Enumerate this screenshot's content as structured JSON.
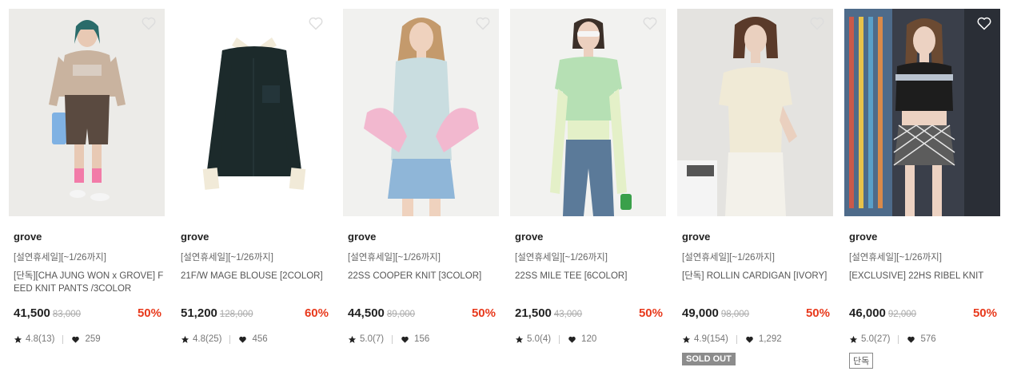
{
  "products": [
    {
      "brand": "grove",
      "promo": "[설연휴세일][~1/26까지]",
      "title": "[단독][CHA JUNG WON x GROVE] FEED KNIT PANTS /3COLOR",
      "price": "41,500",
      "original_price": "83,000",
      "discount": "50%",
      "rating": "4.8(13)",
      "likes": "259",
      "badge": "",
      "image": {
        "bg": "#ecebe8",
        "top": "#c9b39f",
        "bottom": "#5a4a40",
        "hair": "#2a6b6a",
        "skin": "#e8c9b4"
      }
    },
    {
      "brand": "grove",
      "promo": "[설연휴세일][~1/26까지]",
      "title": "21F/W MAGE BLOUSE [2COLOR]",
      "price": "51,200",
      "original_price": "128,000",
      "discount": "60%",
      "rating": "4.8(25)",
      "likes": "456",
      "badge": "",
      "image": {
        "bg": "#ffffff",
        "top": "#1c2a2b",
        "bottom": "#1c2a2b",
        "hair": "#f1ead8",
        "skin": "#f1ead8"
      }
    },
    {
      "brand": "grove",
      "promo": "[설연휴세일][~1/26까지]",
      "title": "22SS COOPER KNIT [3COLOR]",
      "price": "44,500",
      "original_price": "89,000",
      "discount": "50%",
      "rating": "5.0(7)",
      "likes": "156",
      "badge": "",
      "image": {
        "bg": "#f1f1ef",
        "top": "#c9dde0",
        "bottom": "#8fb6d8",
        "hair": "#c49a6c",
        "skin": "#efd2be"
      }
    },
    {
      "brand": "grove",
      "promo": "[설연휴세일][~1/26까지]",
      "title": "22SS MILE TEE [6COLOR]",
      "price": "21,500",
      "original_price": "43,000",
      "discount": "50%",
      "rating": "5.0(4)",
      "likes": "120",
      "badge": "",
      "image": {
        "bg": "#f2f2f0",
        "top": "#b6e0b4",
        "bottom": "#5b7a99",
        "hair": "#3b2f28",
        "skin": "#ecd0bf"
      }
    },
    {
      "brand": "grove",
      "promo": "[설연휴세일][~1/26까지]",
      "title": "[단독] ROLLIN CARDIGAN [IVORY]",
      "price": "49,000",
      "original_price": "98,000",
      "discount": "50%",
      "rating": "4.9(154)",
      "likes": "1,292",
      "badge": "SOLD OUT",
      "image": {
        "bg": "#e4e3e0",
        "top": "#f0ead6",
        "bottom": "#f3f1ea",
        "hair": "#5a3a2a",
        "skin": "#ead0bf"
      }
    },
    {
      "brand": "grove",
      "promo": "[설연휴세일][~1/26까지]",
      "title": "[EXCLUSIVE] 22HS RIBEL KNIT",
      "price": "46,000",
      "original_price": "92,000",
      "discount": "50%",
      "rating": "5.0(27)",
      "likes": "576",
      "badge": "단독",
      "image": {
        "bg": "#3a3f4a",
        "top": "#1d1d1d",
        "bottom": "#5c5c5c",
        "hair": "#6b4a32",
        "skin": "#ecd2c2"
      }
    }
  ]
}
